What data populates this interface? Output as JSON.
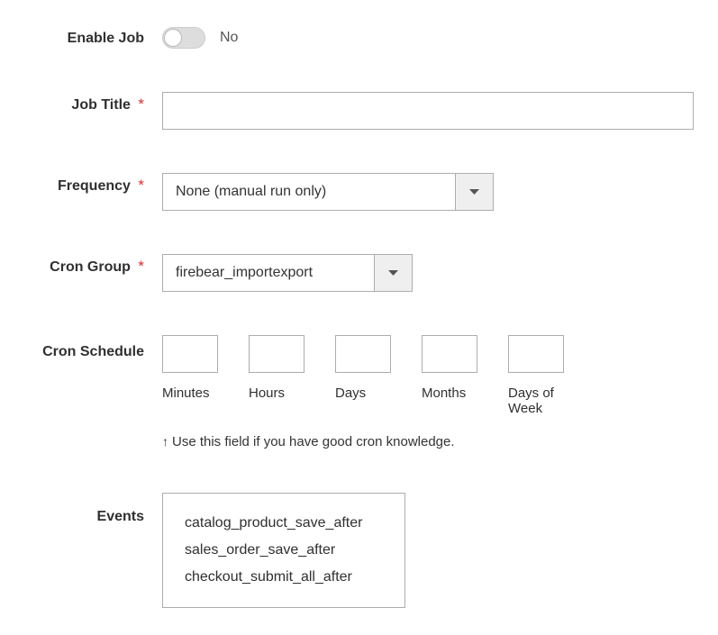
{
  "labels": {
    "enable_job": "Enable Job",
    "job_title": "Job Title",
    "frequency": "Frequency",
    "cron_group": "Cron Group",
    "cron_schedule": "Cron Schedule",
    "events": "Events",
    "required": "*"
  },
  "enable_job": {
    "value": false,
    "text": "No"
  },
  "job_title": {
    "value": ""
  },
  "frequency": {
    "selected": "None (manual run only)"
  },
  "cron_group": {
    "selected": "firebear_importexport"
  },
  "cron_schedule": {
    "minutes": {
      "label": "Minutes",
      "value": ""
    },
    "hours": {
      "label": "Hours",
      "value": ""
    },
    "days": {
      "label": "Days",
      "value": ""
    },
    "months": {
      "label": "Months",
      "value": ""
    },
    "dow": {
      "label": "Days of Week",
      "value": ""
    },
    "note_arrow": "↑",
    "note": "Use this field if you have good cron knowledge."
  },
  "events": {
    "items": {
      "i0": "catalog_product_save_after",
      "i1": "sales_order_save_after",
      "i2": "checkout_submit_all_after"
    }
  }
}
